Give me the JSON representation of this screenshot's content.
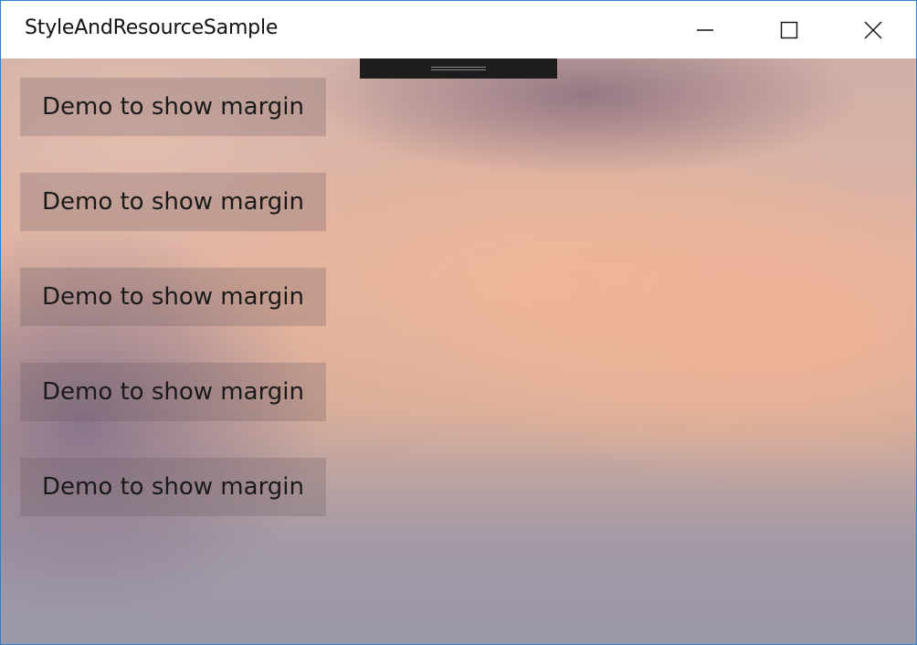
{
  "window": {
    "title": "StyleAndResourceSample",
    "controls": {
      "minimize_icon": "minimize-icon",
      "maximize_icon": "maximize-icon",
      "close_icon": "close-icon"
    },
    "accent_color": "#2b7fd0"
  },
  "content": {
    "buttons": [
      {
        "label": "Demo to show margin"
      },
      {
        "label": "Demo to show margin"
      },
      {
        "label": "Demo to show margin"
      },
      {
        "label": "Demo to show margin"
      },
      {
        "label": "Demo to show margin"
      }
    ]
  }
}
